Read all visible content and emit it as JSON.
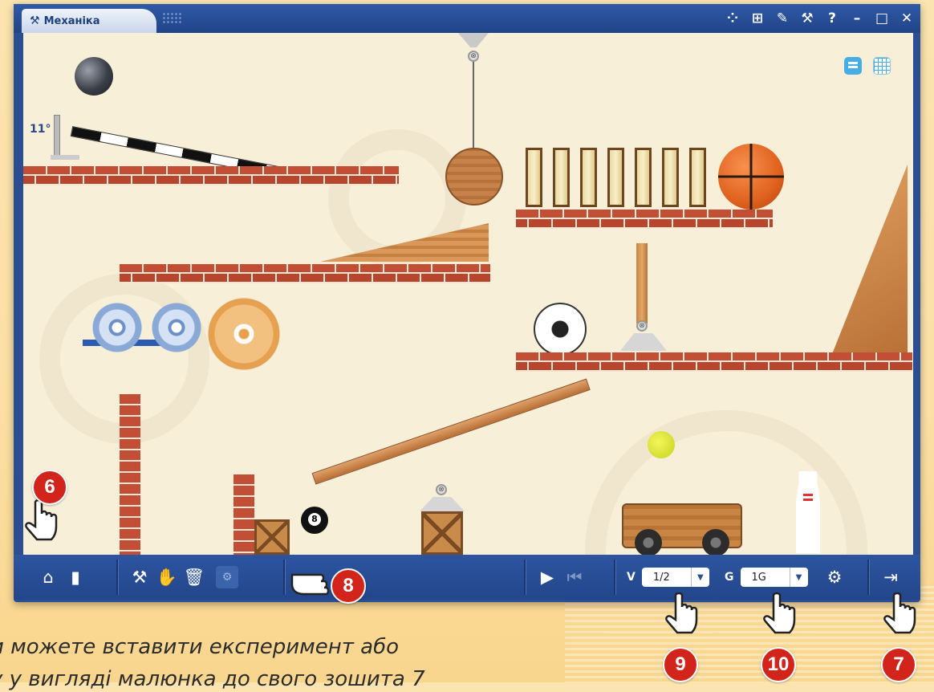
{
  "window": {
    "tab_title": "Механіка",
    "title_icons": [
      "molecule-icon",
      "layers-icon",
      "pencil-icon",
      "wrench-icon",
      "help-icon",
      "minimize-icon",
      "maximize-icon",
      "close-icon"
    ],
    "title_glyphs": [
      "⁘",
      "⊞",
      "✎",
      "⚒",
      "?",
      "–",
      "□",
      "✕"
    ]
  },
  "scene": {
    "angle_label": "11°",
    "eight_ball_label": "8"
  },
  "toolbar": {
    "speed_label": "V",
    "speed_value": "1/2",
    "gravity_label": "G",
    "gravity_value": "1G"
  },
  "callouts": [
    "6",
    "7",
    "8",
    "9",
    "10"
  ],
  "caption": {
    "line1": "и можете вставити експеримент або",
    "line2": "у у вигляді малюнка до свого зошита 7"
  }
}
